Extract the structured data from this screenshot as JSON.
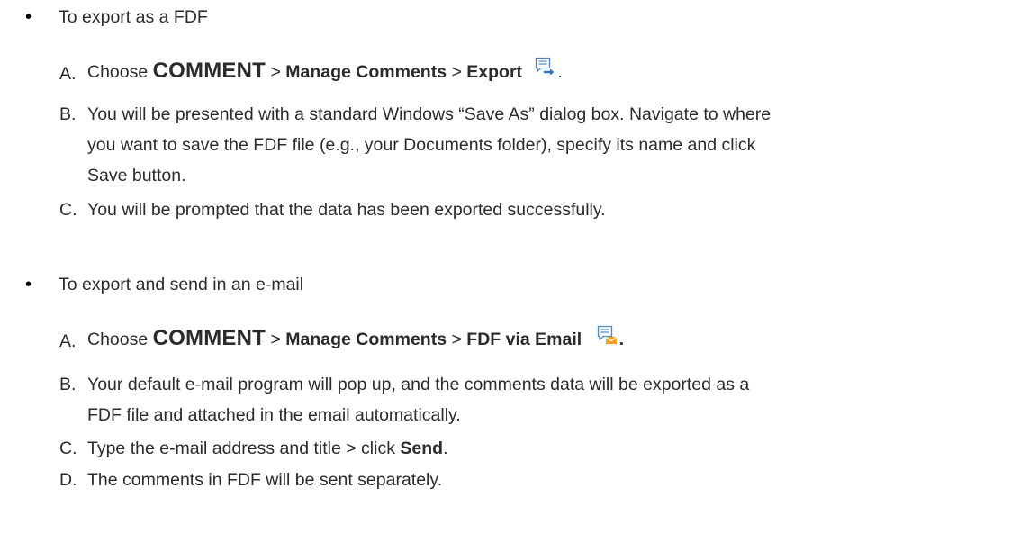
{
  "section1": {
    "bullet": "•",
    "heading": "To export as a FDF",
    "steps": [
      {
        "letter": "A.",
        "pre": "Choose ",
        "menu": "COMMENT",
        "sep1": " > ",
        "sub": "Manage Comments",
        "sep2": " > ",
        "item": "Export",
        "icon": "export-comments-icon",
        "end": "."
      },
      {
        "letter": "B.",
        "lines": [
          "You will be presented with a standard Windows “Save As” dialog box. Navigate to where",
          "you want to save the FDF file (e.g., your Documents folder), specify its name and click",
          "Save button."
        ]
      },
      {
        "letter": "C.",
        "text": "You will be prompted that the data has been exported successfully."
      }
    ]
  },
  "section2": {
    "bullet": "•",
    "heading": "To export and send in an e-mail",
    "steps": [
      {
        "letter": "A.",
        "pre": "Choose ",
        "menu": "COMMENT",
        "sep1": " > ",
        "sub": "Manage Comments",
        "sep2": " > ",
        "item": "FDF via Email",
        "icon": "email-comments-icon",
        "end": "."
      },
      {
        "letter": "B.",
        "lines": [
          "Your default e-mail program will pop up, and the comments data will be exported as a",
          "FDF file and attached in the email automatically."
        ]
      },
      {
        "letter": "C.",
        "pre": "Type the e-mail address and title > click ",
        "bold": "Send",
        "end": "."
      },
      {
        "letter": "D.",
        "text": "The comments in FDF will be sent separately."
      }
    ]
  },
  "colors": {
    "text": "#2b2b2b",
    "icon_outline": "#4a86c7",
    "icon_arrow": "#2a6fc4",
    "icon_envelope": "#f0a020"
  }
}
